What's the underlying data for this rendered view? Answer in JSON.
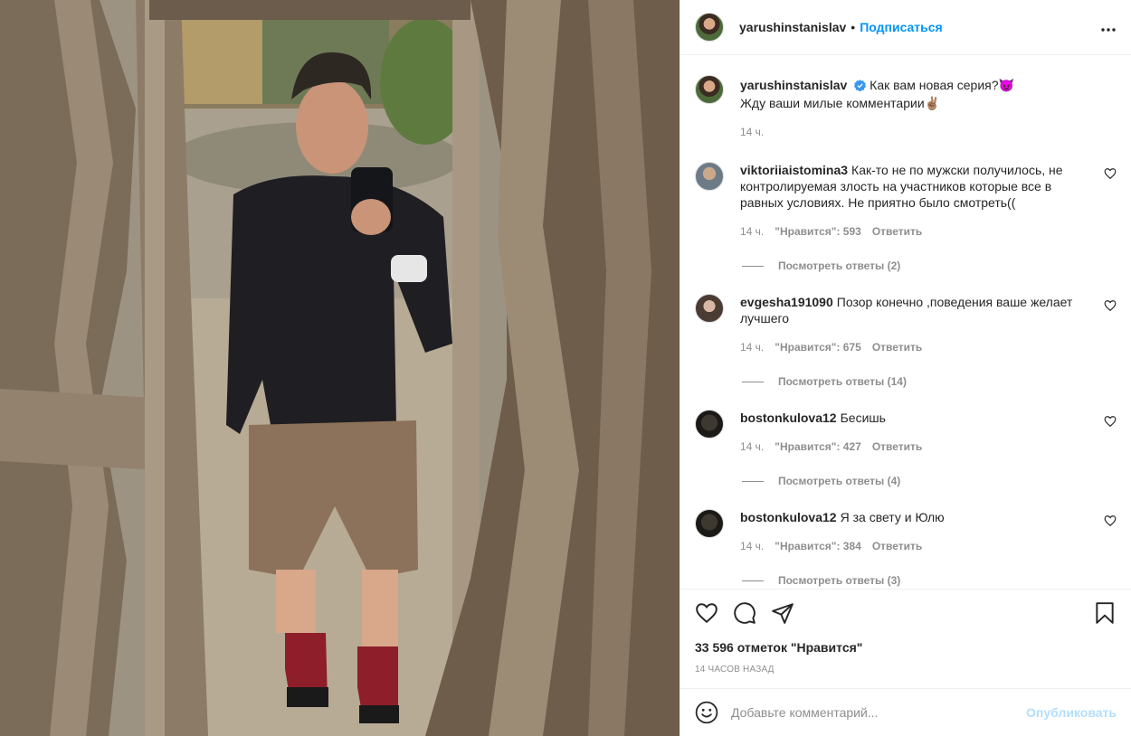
{
  "post": {
    "author": "yarushinstanislav",
    "dot": "•",
    "follow_label": "Подписаться",
    "more_icon": "more-horizontal-icon",
    "verified_icon": "verified-badge-icon"
  },
  "caption": {
    "username": "yarushinstanislav",
    "line1": "Как вам новая серия?😈",
    "line2": "Жду ваши милые комментарии✌🏽",
    "time": "14 ч."
  },
  "comments": [
    {
      "username": "viktoriiaistomina3",
      "text": "Как-то не по мужски получилось, не контролируемая злость на участников которые все в равных условиях. Не приятно было смотреть((",
      "time": "14 ч.",
      "likes": "\"Нравится\": 593",
      "reply": "Ответить",
      "view_replies": "Посмотреть ответы (2)"
    },
    {
      "username": "evgesha191090",
      "text": "Позор конечно ,поведения ваше желает лучшего",
      "time": "14 ч.",
      "likes": "\"Нравится\": 675",
      "reply": "Ответить",
      "view_replies": "Посмотреть ответы (14)"
    },
    {
      "username": "bostonkulova12",
      "text": "Бесишь",
      "time": "14 ч.",
      "likes": "\"Нравится\": 427",
      "reply": "Ответить",
      "view_replies": "Посмотреть ответы (4)"
    },
    {
      "username": "bostonkulova12",
      "text": "Я за свету и Юлю",
      "time": "14 ч.",
      "likes": "\"Нравится\": 384",
      "reply": "Ответить",
      "view_replies": "Посмотреть ответы (3)"
    }
  ],
  "actions": {
    "like_icon": "heart-icon",
    "comment_icon": "comment-bubble-icon",
    "share_icon": "paper-plane-icon",
    "save_icon": "bookmark-icon",
    "likes_count": "33 596 отметок \"Нравится\"",
    "posted": "14 ЧАСОВ НАЗАД"
  },
  "add_comment": {
    "placeholder": "Добавьте комментарий...",
    "post_label": "Опубликовать",
    "emoji_icon": "smiley-icon"
  },
  "colors": {
    "accent": "#0095f6",
    "accent_disabled": "#b2dffc",
    "muted_text": "#8e8e8e",
    "verified": "#3897f0"
  }
}
